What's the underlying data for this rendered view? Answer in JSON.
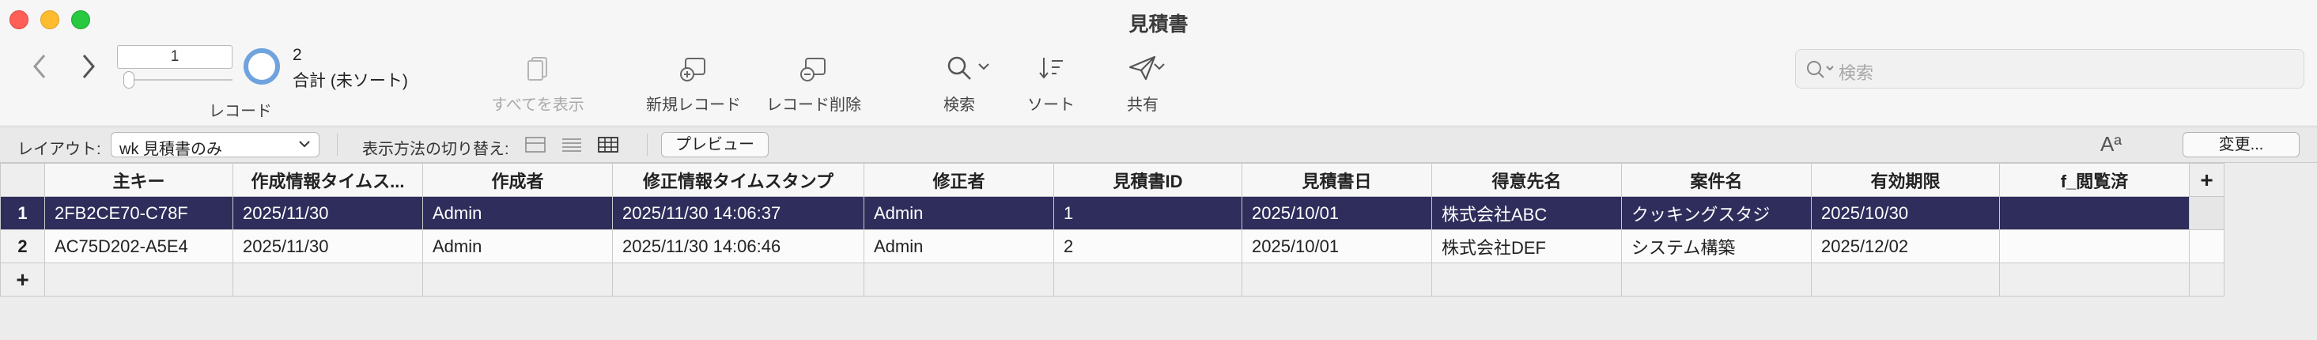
{
  "window": {
    "title": "見積書"
  },
  "toolbar": {
    "record_input": "1",
    "found_count": "2",
    "found_label": "合計 (未ソート)",
    "records_label": "レコード",
    "show_all_label": "すべてを表示",
    "new_record_label": "新規レコード",
    "delete_record_label": "レコード削除",
    "find_label": "検索",
    "sort_label": "ソート",
    "share_label": "共有",
    "search_placeholder": "検索"
  },
  "layoutbar": {
    "layout_label": "レイアウト:",
    "layout_value": "wk 見積書のみ",
    "view_as_label": "表示方法の切り替え:",
    "preview_label": "プレビュー",
    "aa_label": "Aª",
    "change_label": "変更..."
  },
  "table": {
    "columns": [
      "主キー",
      "作成情報タイムス...",
      "作成者",
      "修正情報タイムスタンプ",
      "修正者",
      "見積書ID",
      "見積書日",
      "得意先名",
      "案件名",
      "有効期限",
      "f_閲覧済"
    ],
    "add_column": "+",
    "rows": [
      {
        "num": "1",
        "cells": [
          "2FB2CE70-C78F",
          "2025/11/30",
          "Admin",
          "2025/11/30 14:06:37",
          "Admin",
          "1",
          "2025/10/01",
          "株式会社ABC",
          "クッキングスタジ",
          "2025/10/30",
          ""
        ]
      },
      {
        "num": "2",
        "cells": [
          "AC75D202-A5E4",
          "2025/11/30",
          "Admin",
          "2025/11/30 14:06:46",
          "Admin",
          "2",
          "2025/10/01",
          "株式会社DEF",
          "システム構築",
          "2025/12/02",
          ""
        ]
      }
    ],
    "add_row": "+"
  },
  "colors": {
    "selection": "#2e2d5b",
    "accent": "#6fa3dd"
  },
  "icons": [
    "back-arrow-icon",
    "forward-arrow-icon",
    "show-all-icon",
    "new-record-icon",
    "delete-record-icon",
    "find-icon",
    "sort-icon",
    "share-icon",
    "search-icon",
    "form-view-icon",
    "list-view-icon",
    "table-view-icon"
  ]
}
